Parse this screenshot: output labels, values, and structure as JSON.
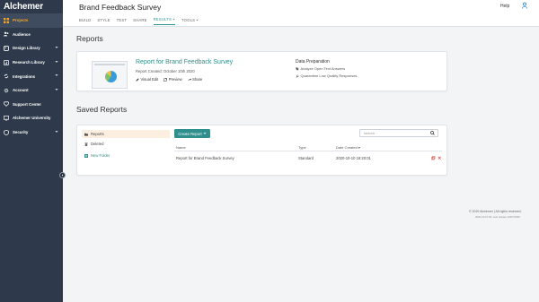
{
  "app": {
    "logo": "Alchemer"
  },
  "sidebar": {
    "items": [
      {
        "label": "Projects",
        "icon": "grid-icon",
        "active": true,
        "chevron": false
      },
      {
        "label": "Audience",
        "icon": "users-icon",
        "active": false,
        "chevron": false
      },
      {
        "label": "Design Library",
        "icon": "palette-icon",
        "active": false,
        "chevron": true
      },
      {
        "label": "Research Library",
        "icon": "bar-chart-icon",
        "active": false,
        "chevron": true
      },
      {
        "label": "Integrations",
        "icon": "sync-icon",
        "active": false,
        "chevron": true
      },
      {
        "label": "Account",
        "icon": "gear-icon",
        "active": false,
        "chevron": true
      },
      {
        "label": "Support Center",
        "icon": "heart-icon",
        "active": false,
        "chevron": false
      },
      {
        "label": "Alchemer University",
        "icon": "monitor-icon",
        "active": false,
        "chevron": false
      },
      {
        "label": "Security",
        "icon": "shield-icon",
        "active": false,
        "chevron": true
      }
    ]
  },
  "header": {
    "survey_title": "Brand Feedback Survey",
    "tabs": [
      {
        "label": "BUILD"
      },
      {
        "label": "STYLE"
      },
      {
        "label": "TEST"
      },
      {
        "label": "SHARE"
      },
      {
        "label": "RESULTS",
        "active": true,
        "dropdown": true
      },
      {
        "label": "TOOLS",
        "dropdown": true
      }
    ],
    "help": "Help"
  },
  "reports": {
    "section_title": "Reports",
    "report": {
      "name": "Report for Brand Feedback Survey",
      "created": "Report Created: October 10th 2020",
      "actions": {
        "visual_edit": "Visual Edit",
        "preview": "Preview",
        "share": "Share"
      }
    },
    "data_prep": {
      "title": "Data Preparation",
      "analyze": "Analyze Open Text Answers",
      "quarantine": "Quarantine Low Quality Responses"
    }
  },
  "saved": {
    "section_title": "Saved Reports",
    "folders": {
      "reports": "Reports",
      "deleted": "Deleted",
      "new_folder": "New Folder"
    },
    "create_button": "Create Report",
    "search_placeholder": "search",
    "columns": {
      "name": "Name",
      "type": "Type",
      "date": "Date Created ▾"
    },
    "rows": [
      {
        "name": "Report for Brand Feedback Survey",
        "type": "Standard",
        "date": "2020-10-10 18:20:01"
      }
    ]
  },
  "footer": {
    "copyright": "© 2020 Alchemer | All rights reserved.",
    "build": "2020-10-07.00, Last release 10/07/2020"
  },
  "colors": {
    "accent": "#2f8f8c",
    "sidebar_bg": "#2e3a4b",
    "active_nav": "#f5a623",
    "delete": "#d9534f"
  }
}
